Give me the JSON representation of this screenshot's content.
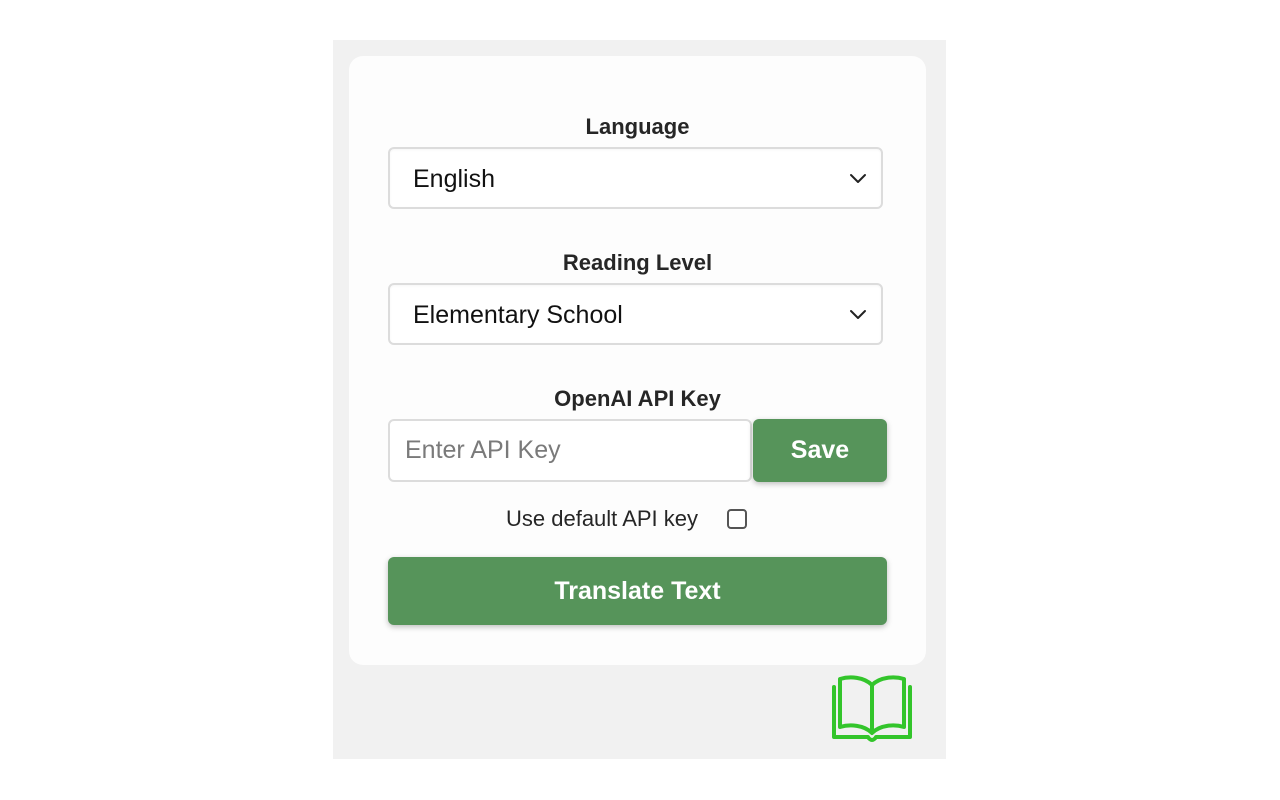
{
  "language": {
    "label": "Language",
    "selected": "English"
  },
  "reading_level": {
    "label": "Reading Level",
    "selected": "Elementary School"
  },
  "api_key": {
    "label": "OpenAI API Key",
    "placeholder": "Enter API Key",
    "value": "",
    "save_label": "Save"
  },
  "default_key": {
    "label": "Use default API key",
    "checked": false
  },
  "translate": {
    "label": "Translate Text"
  },
  "icons": {
    "select_arrow": "chevron-down-icon",
    "logo": "book-icon"
  },
  "colors": {
    "accent": "#56945a",
    "logo": "#33c52b",
    "panel_bg": "#f1f1f1",
    "card_bg": "#fdfdfd"
  }
}
